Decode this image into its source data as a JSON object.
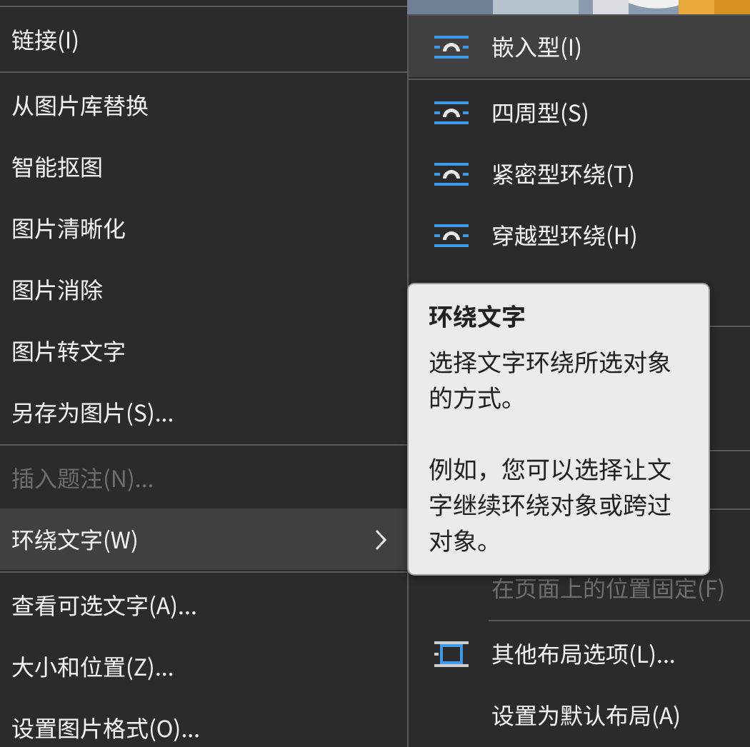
{
  "context_menu": {
    "items": [
      {
        "kind": "separator"
      },
      {
        "kind": "item",
        "label": "链接(I)",
        "selected": false,
        "disabled": false,
        "submenu": false
      },
      {
        "kind": "separator"
      },
      {
        "kind": "item",
        "label": "从图片库替换",
        "selected": false,
        "disabled": false,
        "submenu": false
      },
      {
        "kind": "item",
        "label": "智能抠图",
        "selected": false,
        "disabled": false,
        "submenu": false
      },
      {
        "kind": "item",
        "label": "图片清晰化",
        "selected": false,
        "disabled": false,
        "submenu": false
      },
      {
        "kind": "item",
        "label": "图片消除",
        "selected": false,
        "disabled": false,
        "submenu": false
      },
      {
        "kind": "item",
        "label": "图片转文字",
        "selected": false,
        "disabled": false,
        "submenu": false
      },
      {
        "kind": "item",
        "label": "另存为图片(S)...",
        "selected": false,
        "disabled": false,
        "submenu": false
      },
      {
        "kind": "separator"
      },
      {
        "kind": "item",
        "label": "插入题注(N)...",
        "selected": false,
        "disabled": true,
        "submenu": false
      },
      {
        "kind": "item",
        "label": "环绕文字(W)",
        "selected": true,
        "disabled": false,
        "submenu": true
      },
      {
        "kind": "separator"
      },
      {
        "kind": "item",
        "label": "查看可选文字(A)...",
        "selected": false,
        "disabled": false,
        "submenu": false
      },
      {
        "kind": "item",
        "label": "大小和位置(Z)...",
        "selected": false,
        "disabled": false,
        "submenu": false
      },
      {
        "kind": "item",
        "label": "设置图片格式(O)...",
        "selected": false,
        "disabled": false,
        "submenu": false
      }
    ]
  },
  "submenu": {
    "top_items": [
      {
        "kind": "wrap",
        "label": "嵌入型(I)",
        "selected": true,
        "disabled": false
      },
      {
        "kind": "wrap",
        "label": "四周型(S)",
        "selected": false,
        "disabled": false
      },
      {
        "kind": "wrap",
        "label": "紧密型环绕(T)",
        "selected": false,
        "disabled": false
      },
      {
        "kind": "wrap",
        "label": "穿越型环绕(H)",
        "selected": false,
        "disabled": false
      }
    ],
    "bottom_items": [
      {
        "kind": "text",
        "label": "在页面上的位置固定(F)",
        "selected": false,
        "disabled": true
      },
      {
        "kind": "separator"
      },
      {
        "kind": "layout",
        "label": "其他布局选项(L)...",
        "selected": false,
        "disabled": false
      },
      {
        "kind": "text",
        "label": "设置为默认布局(A)",
        "selected": false,
        "disabled": false
      }
    ]
  },
  "tooltip": {
    "title": "环绕文字",
    "paragraphs": [
      "选择文字环绕所选对象的方式。",
      "例如，您可以选择让文字继续环绕对象或跨过对象。"
    ]
  }
}
